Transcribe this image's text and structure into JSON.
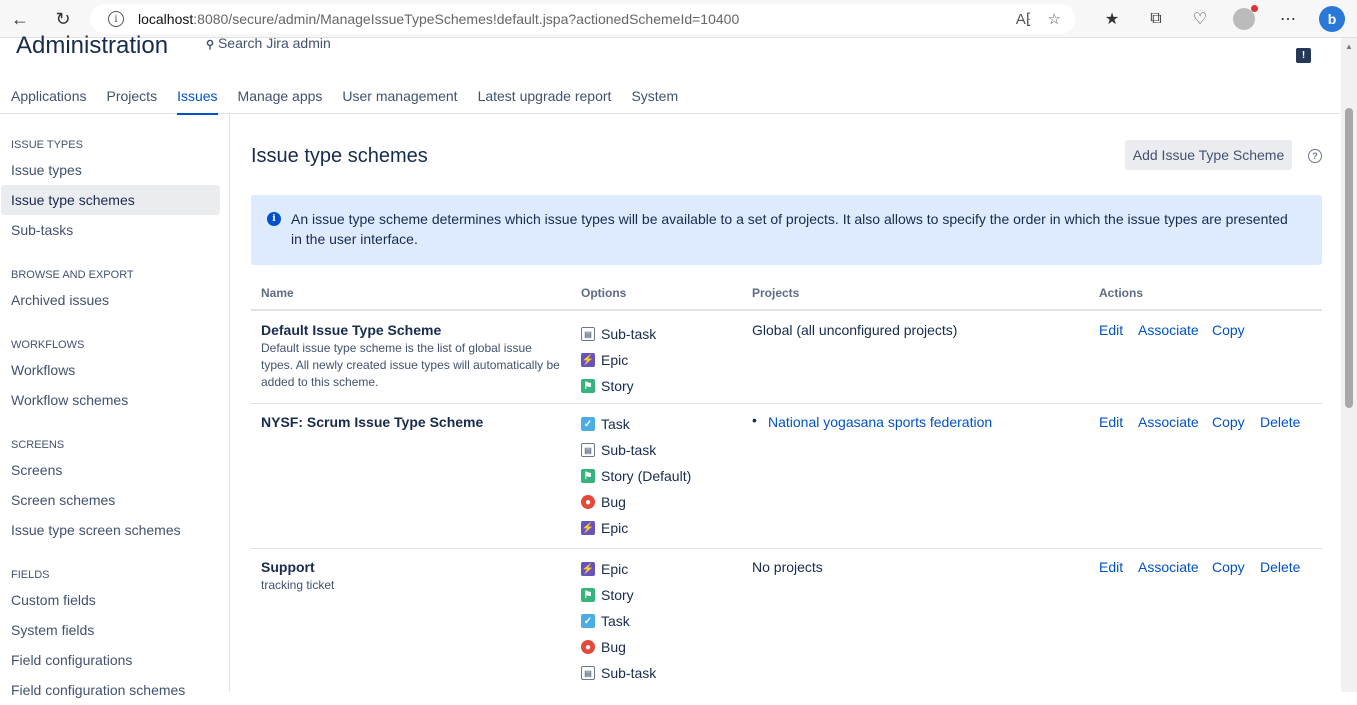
{
  "browser": {
    "url_host": "localhost",
    "url_path": ":8080/secure/admin/ManageIssueTypeSchemes!default.jspa?actionedSchemeId=10400"
  },
  "header": {
    "title": "Administration",
    "search_label": "Search Jira admin"
  },
  "top_nav": [
    "Applications",
    "Projects",
    "Issues",
    "Manage apps",
    "User management",
    "Latest upgrade report",
    "System"
  ],
  "top_nav_active": "Issues",
  "sidebar": {
    "sections": [
      {
        "heading": "ISSUE TYPES",
        "items": [
          "Issue types",
          "Issue type schemes",
          "Sub-tasks"
        ]
      },
      {
        "heading": "BROWSE AND EXPORT",
        "items": [
          "Archived issues"
        ]
      },
      {
        "heading": "WORKFLOWS",
        "items": [
          "Workflows",
          "Workflow schemes"
        ]
      },
      {
        "heading": "SCREENS",
        "items": [
          "Screens",
          "Screen schemes",
          "Issue type screen schemes"
        ]
      },
      {
        "heading": "FIELDS",
        "items": [
          "Custom fields",
          "System fields",
          "Field configurations",
          "Field configuration schemes"
        ]
      }
    ],
    "active_item": "Issue type schemes"
  },
  "main": {
    "title": "Issue type schemes",
    "add_button": "Add Issue Type Scheme",
    "info_text": "An issue type scheme determines which issue types will be available to a set of projects. It also allows to specify the order in which the issue types are presented in the user interface.",
    "columns": [
      "Name",
      "Options",
      "Projects",
      "Actions"
    ],
    "schemes": [
      {
        "name": "Default Issue Type Scheme",
        "description": "Default issue type scheme is the list of global issue types. All newly created issue types will automatically be added to this scheme.",
        "options": [
          {
            "label": "Sub-task",
            "icon": "subtask"
          },
          {
            "label": "Epic",
            "icon": "epic"
          },
          {
            "label": "Story",
            "icon": "story"
          }
        ],
        "projects_text": "Global (all unconfigured projects)",
        "actions": [
          "Edit",
          "Associate",
          "Copy"
        ]
      },
      {
        "name": "NYSF: Scrum Issue Type Scheme",
        "description": "",
        "options": [
          {
            "label": "Task",
            "icon": "task"
          },
          {
            "label": "Sub-task",
            "icon": "subtask"
          },
          {
            "label": "Story (Default)",
            "icon": "story"
          },
          {
            "label": "Bug",
            "icon": "bug"
          },
          {
            "label": "Epic",
            "icon": "epic"
          }
        ],
        "projects_link": "National yogasana sports federation",
        "actions": [
          "Edit",
          "Associate",
          "Copy",
          "Delete"
        ]
      },
      {
        "name": "Support",
        "description": "tracking ticket",
        "options": [
          {
            "label": "Epic",
            "icon": "epic"
          },
          {
            "label": "Story",
            "icon": "story"
          },
          {
            "label": "Task",
            "icon": "task"
          },
          {
            "label": "Bug",
            "icon": "bug"
          },
          {
            "label": "Sub-task",
            "icon": "subtask"
          }
        ],
        "projects_text": "No projects",
        "actions": [
          "Edit",
          "Associate",
          "Copy",
          "Delete"
        ]
      }
    ]
  }
}
